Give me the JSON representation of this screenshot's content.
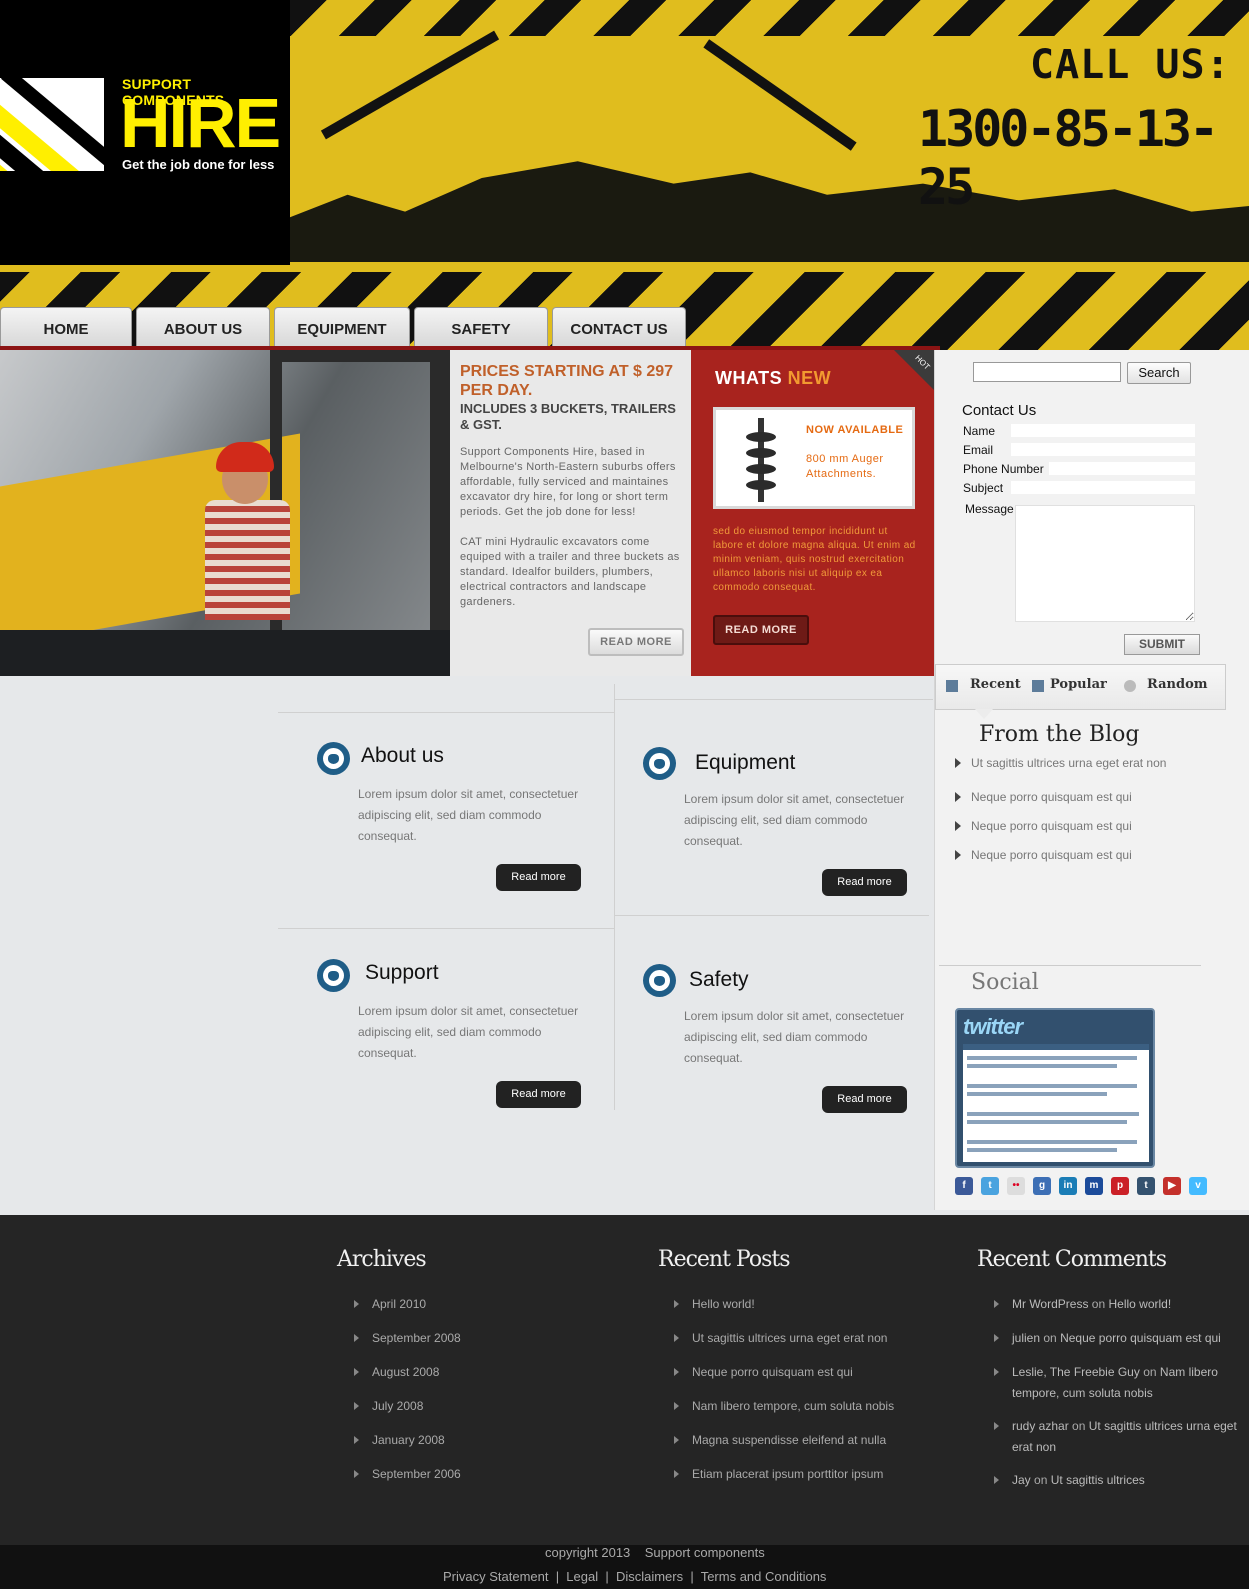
{
  "header": {
    "logo_kicker": "SUPPORT COMPONENTS",
    "logo_word": "HIRE",
    "logo_tagline": "Get the job done for less",
    "call_us": "CALL US:",
    "phone": "1300-85-13-25"
  },
  "nav": [
    "HOME",
    "ABOUT US",
    "EQUIPMENT",
    "SAFETY",
    "CONTACT US"
  ],
  "hero": {
    "price": "PRICES STARTING AT $ 297 PER DAY.",
    "includes": "INCLUDES 3 BUCKETS, TRAILERS & GST.",
    "para1": "Support Components Hire, based in Melbourne's North-Eastern suburbs offers affordable, fully serviced and maintaines excavator dry hire, for long or  short term periods. Get the job done for less!",
    "para2": "CAT mini Hydraulic excavators come equiped with a trailer and three buckets as standard. Idealfor builders, plumbers, electrical contractors and landscape gardeners.",
    "read_more": "READ MORE"
  },
  "whats_new": {
    "title_a": "WHATS",
    "title_b": "NEW",
    "hot": "HOT",
    "now_available": "NOW AVAILABLE",
    "product": "800 mm Auger Attachments.",
    "para": "sed do eiusmod tempor incididunt ut labore et dolore magna aliqua. Ut enim ad minim veniam, quis nostrud exercitation ullamco laboris nisi ut aliquip ex ea commodo consequat.",
    "read_more": "READ MORE"
  },
  "sidebar": {
    "search_button": "Search",
    "contact_title": "Contact Us",
    "fields": [
      "Name",
      "Email",
      "Phone Number",
      "Subject",
      "Message"
    ],
    "submit": "SUBMIT",
    "tabs": [
      "Recent",
      "Popular",
      "Random"
    ],
    "blog_title": "From the Blog",
    "blog_items": [
      "Ut sagittis ultrices urna eget erat non",
      "Neque porro quisquam est qui",
      "Neque porro quisquam est qui",
      "Neque porro quisquam est qui"
    ],
    "social_title": "Social",
    "twitter_logo": "twitter",
    "social_icons": [
      "facebook-icon",
      "twitter-icon",
      "flickr-icon",
      "google-icon",
      "linkedin-icon",
      "myspace-icon",
      "pinterest-icon",
      "tumblr-icon",
      "youtube-icon",
      "vimeo-icon"
    ]
  },
  "features": [
    {
      "title": "About us",
      "text": "Lorem ipsum dolor sit amet, consectetuer adipiscing elit, sed diam commodo consequat.",
      "button": "Read more"
    },
    {
      "title": "Equipment",
      "text": "Lorem ipsum dolor sit amet, consectetuer adipiscing elit, sed diam commodo consequat.",
      "button": "Read more"
    },
    {
      "title": "Support",
      "text": "Lorem ipsum dolor sit amet, consectetuer adipiscing elit, sed diam commodo consequat.",
      "button": "Read more"
    },
    {
      "title": "Safety",
      "text": "Lorem ipsum dolor sit amet, consectetuer adipiscing elit, sed diam commodo consequat.",
      "button": "Read more"
    }
  ],
  "footer": {
    "archives_title": "Archives",
    "archives": [
      "April 2010",
      "September 2008",
      "August 2008",
      "July 2008",
      "January 2008",
      "September 2006"
    ],
    "recent_posts_title": "Recent Posts",
    "recent_posts": [
      "Hello world!",
      "Ut sagittis ultrices urna eget erat non",
      "Neque porro quisquam est qui",
      "Nam libero tempore, cum soluta nobis",
      "Magna suspendisse eleifend at nulla",
      "Etiam placerat ipsum porttitor ipsum"
    ],
    "recent_comments_title": "Recent Comments",
    "recent_comments": [
      {
        "author": "Mr WordPress",
        "on": "on",
        "post": "Hello world!"
      },
      {
        "author": "julien",
        "on": "on",
        "post": "Neque porro quisquam est qui"
      },
      {
        "author": "Leslie, The Freebie Guy",
        "on": "on",
        "post": "Nam libero tempore, cum soluta nobis"
      },
      {
        "author": "rudy azhar",
        "on": "on",
        "post": "Ut sagittis ultrices urna eget erat non"
      },
      {
        "author": "Jay",
        "on": "on",
        "post": "Ut sagittis ultrices"
      }
    ],
    "copyright": "copyright 2013    Support components",
    "legal": "Privacy Statement  |  Legal  |  Disclaimers  |  Terms and Conditions"
  },
  "colors": {
    "brand_yellow": "#e0bd1e",
    "hazard_black": "#111111",
    "accent_red": "#a8231e",
    "price_orange": "#c0602a"
  }
}
